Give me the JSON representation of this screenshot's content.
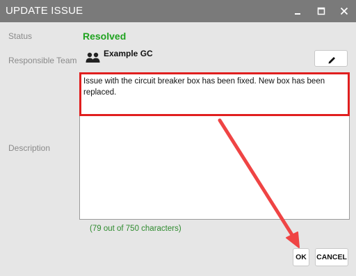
{
  "window": {
    "title": "UPDATE ISSUE",
    "controls": [
      "minimize-icon",
      "maximize-icon",
      "close-icon"
    ]
  },
  "form": {
    "status_label": "Status",
    "status_value": "Resolved",
    "team_label": "Responsible Team",
    "team_value": "Example GC",
    "description_label": "Description",
    "description_value": "Issue with the circuit breaker box has been fixed. New box has been replaced.",
    "char_count": "(79 out of 750 characters)"
  },
  "buttons": {
    "ok": "OK",
    "cancel": "CANCEL"
  },
  "colors": {
    "titlebar": "#7a7a7a",
    "status": "#1fa31f",
    "annotation": "#e01f1f",
    "char_count": "#2e8b2e"
  }
}
